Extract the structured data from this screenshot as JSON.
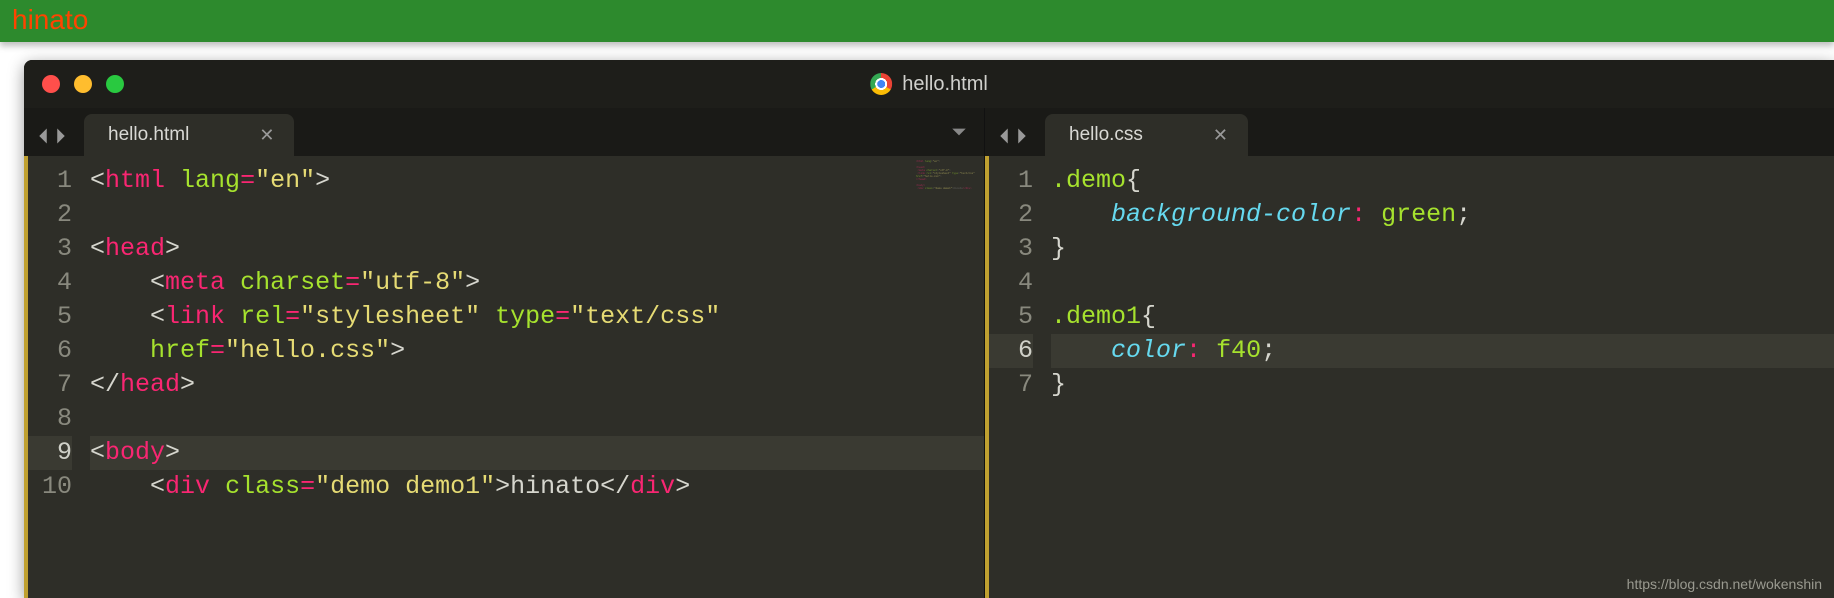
{
  "browser": {
    "demo_text": "hinato"
  },
  "window": {
    "title": "hello.html",
    "traffic": [
      "close",
      "minimize",
      "zoom"
    ]
  },
  "left_pane": {
    "tab_label": "hello.html",
    "line_count": 10,
    "active_line": 9,
    "code_tokens": [
      [
        {
          "t": "<",
          "c": "brk"
        },
        {
          "t": "html",
          "c": "tag"
        },
        {
          "t": " ",
          "c": "brk"
        },
        {
          "t": "lang",
          "c": "attr"
        },
        {
          "t": "=",
          "c": "op"
        },
        {
          "t": "\"en\"",
          "c": "str"
        },
        {
          "t": ">",
          "c": "brk"
        }
      ],
      [],
      [
        {
          "t": "<",
          "c": "brk"
        },
        {
          "t": "head",
          "c": "tag"
        },
        {
          "t": ">",
          "c": "brk"
        }
      ],
      [
        {
          "t": "    ",
          "c": "brk"
        },
        {
          "t": "<",
          "c": "brk"
        },
        {
          "t": "meta",
          "c": "tag"
        },
        {
          "t": " ",
          "c": "brk"
        },
        {
          "t": "charset",
          "c": "attr"
        },
        {
          "t": "=",
          "c": "op"
        },
        {
          "t": "\"utf-8\"",
          "c": "str"
        },
        {
          "t": ">",
          "c": "brk"
        }
      ],
      [
        {
          "t": "    ",
          "c": "brk"
        },
        {
          "t": "<",
          "c": "brk"
        },
        {
          "t": "link",
          "c": "tag"
        },
        {
          "t": " ",
          "c": "brk"
        },
        {
          "t": "rel",
          "c": "attr"
        },
        {
          "t": "=",
          "c": "op"
        },
        {
          "t": "\"stylesheet\"",
          "c": "str"
        },
        {
          "t": " ",
          "c": "brk"
        },
        {
          "t": "type",
          "c": "attr"
        },
        {
          "t": "=",
          "c": "op"
        },
        {
          "t": "\"text/css\"",
          "c": "str"
        }
      ],
      [
        {
          "t": "    ",
          "c": "brk"
        },
        {
          "t": "href",
          "c": "attr"
        },
        {
          "t": "=",
          "c": "op"
        },
        {
          "t": "\"hello.css\"",
          "c": "str"
        },
        {
          "t": ">",
          "c": "brk"
        }
      ],
      [
        {
          "t": "</",
          "c": "brk"
        },
        {
          "t": "head",
          "c": "tag"
        },
        {
          "t": ">",
          "c": "brk"
        }
      ],
      [],
      [
        {
          "t": "<",
          "c": "brk"
        },
        {
          "t": "body",
          "c": "tag"
        },
        {
          "t": ">",
          "c": "brk"
        }
      ],
      [
        {
          "t": "    ",
          "c": "brk"
        },
        {
          "t": "<",
          "c": "brk"
        },
        {
          "t": "div",
          "c": "tag"
        },
        {
          "t": " ",
          "c": "brk"
        },
        {
          "t": "class",
          "c": "attr"
        },
        {
          "t": "=",
          "c": "op"
        },
        {
          "t": "\"demo demo1\"",
          "c": "str"
        },
        {
          "t": ">",
          "c": "brk"
        },
        {
          "t": "hinato",
          "c": "brk"
        },
        {
          "t": "</",
          "c": "brk"
        },
        {
          "t": "div",
          "c": "tag"
        },
        {
          "t": ">",
          "c": "brk"
        }
      ],
      []
    ]
  },
  "right_pane": {
    "tab_label": "hello.css",
    "line_count": 7,
    "active_line": 6,
    "code_tokens": [
      [
        {
          "t": ".demo",
          "c": "sel"
        },
        {
          "t": "{",
          "c": "punc"
        }
      ],
      [
        {
          "t": "    ",
          "c": "punc"
        },
        {
          "t": "background-color",
          "c": "prop"
        },
        {
          "t": ":",
          "c": "op"
        },
        {
          "t": " ",
          "c": "punc"
        },
        {
          "t": "green",
          "c": "val"
        },
        {
          "t": ";",
          "c": "punc"
        }
      ],
      [
        {
          "t": "}",
          "c": "punc"
        }
      ],
      [],
      [
        {
          "t": ".demo1",
          "c": "sel"
        },
        {
          "t": "{",
          "c": "punc"
        }
      ],
      [
        {
          "t": "    ",
          "c": "punc"
        },
        {
          "t": "color",
          "c": "prop"
        },
        {
          "t": ":",
          "c": "op"
        },
        {
          "t": " ",
          "c": "punc"
        },
        {
          "t": "f40",
          "c": "val"
        },
        {
          "t": ";",
          "c": "punc"
        }
      ],
      [
        {
          "t": "}",
          "c": "punc"
        }
      ]
    ]
  },
  "watermark": "https://blog.csdn.net/wokenshin"
}
